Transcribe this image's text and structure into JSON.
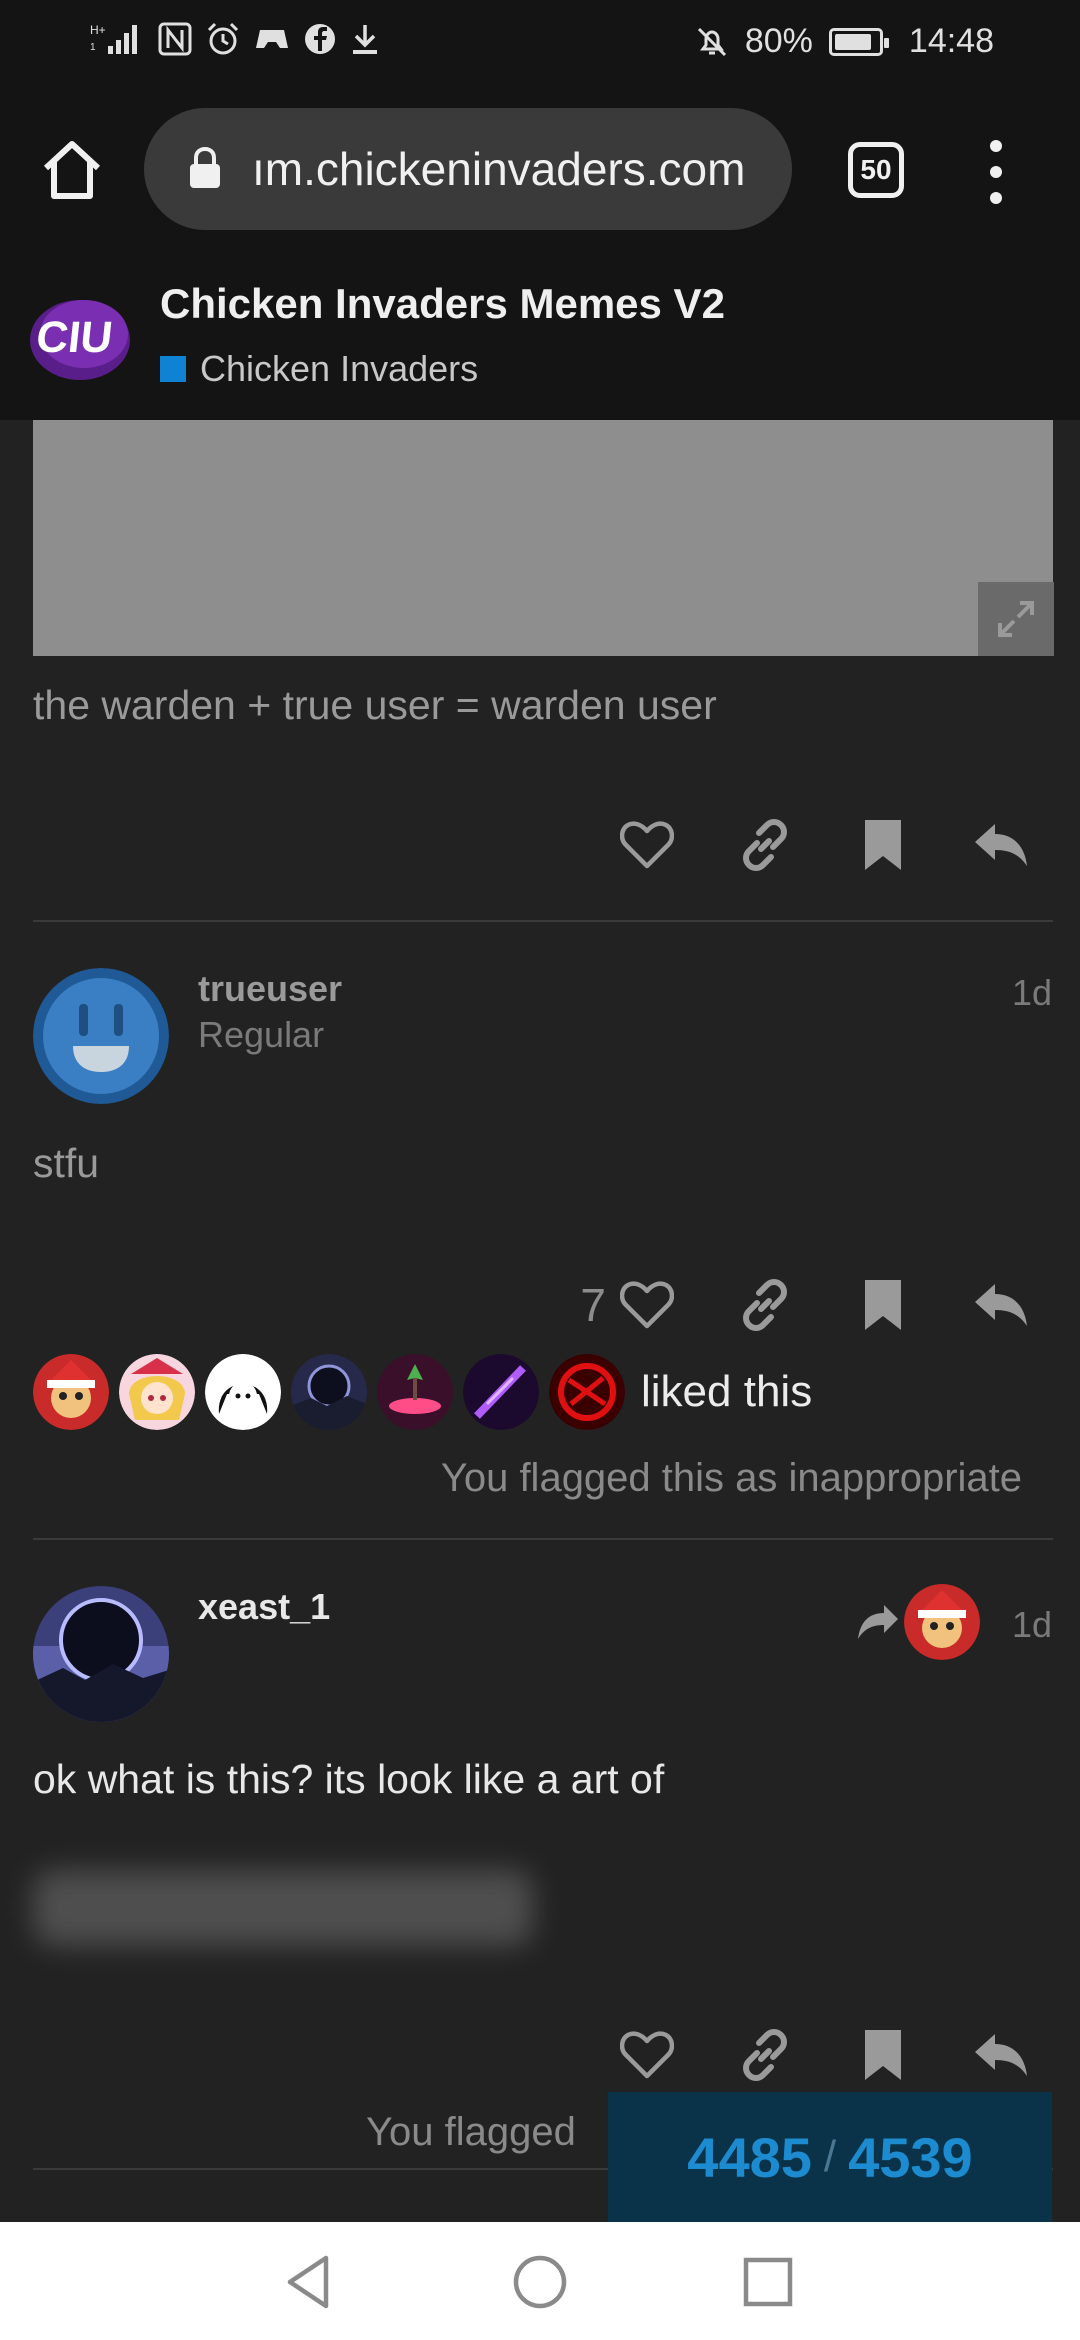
{
  "status_bar": {
    "battery": "80%",
    "time": "14:48",
    "left_icons": [
      "signal-icon",
      "nfc-icon",
      "alarm-icon",
      "game-icon",
      "facebook-icon",
      "download-icon"
    ],
    "right_icons": [
      "mute-icon",
      "battery-icon"
    ]
  },
  "browser": {
    "url": "ım.chickeninvaders.com",
    "tab_count": "50"
  },
  "forum": {
    "logo_text": "CIU",
    "topic_title": "Chicken Invaders Memes V2",
    "category": "Chicken Invaders",
    "category_color": "#0f82d4"
  },
  "posts": [
    {
      "text": "the warden + true user = warden user"
    },
    {
      "username": "trueuser",
      "user_title": "Regular",
      "time": "1d",
      "text": "stfu",
      "like_count": "7",
      "liked_text": "liked this",
      "flag_text": "You flagged this as inappropriate"
    },
    {
      "username": "xeast_1",
      "time": "1d",
      "text": "ok what is this? its look like a art of",
      "flag_text": "You flagged"
    }
  ],
  "progress": {
    "current": "4485",
    "separator": "/",
    "total": "4539"
  }
}
